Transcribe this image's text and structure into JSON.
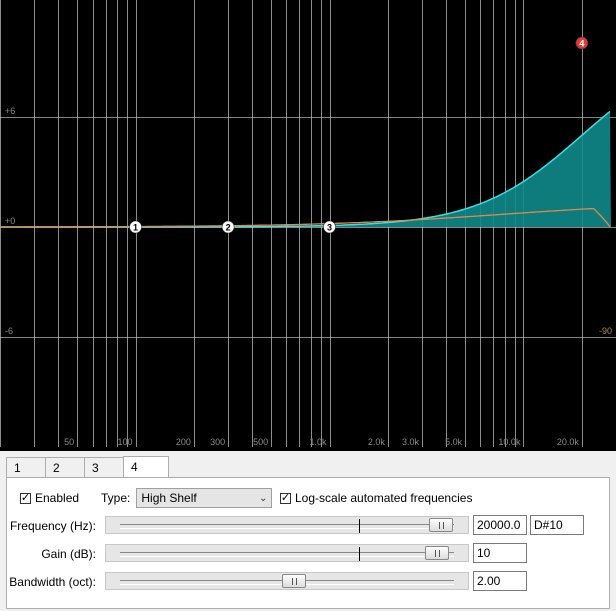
{
  "graph": {
    "x_tick_labels": [
      "50",
      "100",
      "200",
      "300",
      "500",
      "1.0k",
      "2.0k",
      "3.0k",
      "5.0k",
      "10.0k",
      "20.0k"
    ],
    "x_tick_freqs": [
      50,
      100,
      200,
      300,
      500,
      1000,
      2000,
      3000,
      5000,
      10000,
      20000
    ],
    "gain_labels_left": [
      "+6",
      "+0",
      "-6"
    ],
    "gain_labels_right": [
      "-90"
    ],
    "gain_label_values": [
      6,
      0,
      -6
    ],
    "right_axis_values": [
      -90
    ],
    "band_nodes": [
      {
        "label": "1",
        "freq": 100,
        "gain": 0,
        "active": false
      },
      {
        "label": "2",
        "freq": 300,
        "gain": 0,
        "active": false
      },
      {
        "label": "3",
        "freq": 1000,
        "gain": 0,
        "active": false
      },
      {
        "label": "4",
        "freq": 20000,
        "gain": 10,
        "active": true
      }
    ],
    "colors": {
      "background": "#000000",
      "grid": "#cfcfcf",
      "response_fill": "#0f8a8a",
      "response_line": "#38e0e0",
      "phase_line": "#e08a4a",
      "active_node": "#e03a3a",
      "node": "#ffffff"
    }
  },
  "tabs": [
    {
      "label": "1",
      "active": false
    },
    {
      "label": "2",
      "active": false
    },
    {
      "label": "3",
      "active": false
    },
    {
      "label": "4",
      "active": true
    }
  ],
  "settings": {
    "enabled_label": "Enabled",
    "enabled_checked": true,
    "type_label": "Type:",
    "type_value": "High Shelf",
    "log_scale_label": "Log-scale automated frequencies",
    "log_scale_checked": true,
    "frequency_label": "Frequency (Hz):",
    "frequency_value": "20000.0",
    "note_value": "D#10",
    "gain_label": "Gain (dB):",
    "gain_value": "10",
    "bandwidth_label": "Bandwidth (oct):",
    "bandwidth_value": "2.00",
    "frequency_level": 0.96,
    "gain_level": 0.95,
    "bandwidth_level": 0.52
  }
}
